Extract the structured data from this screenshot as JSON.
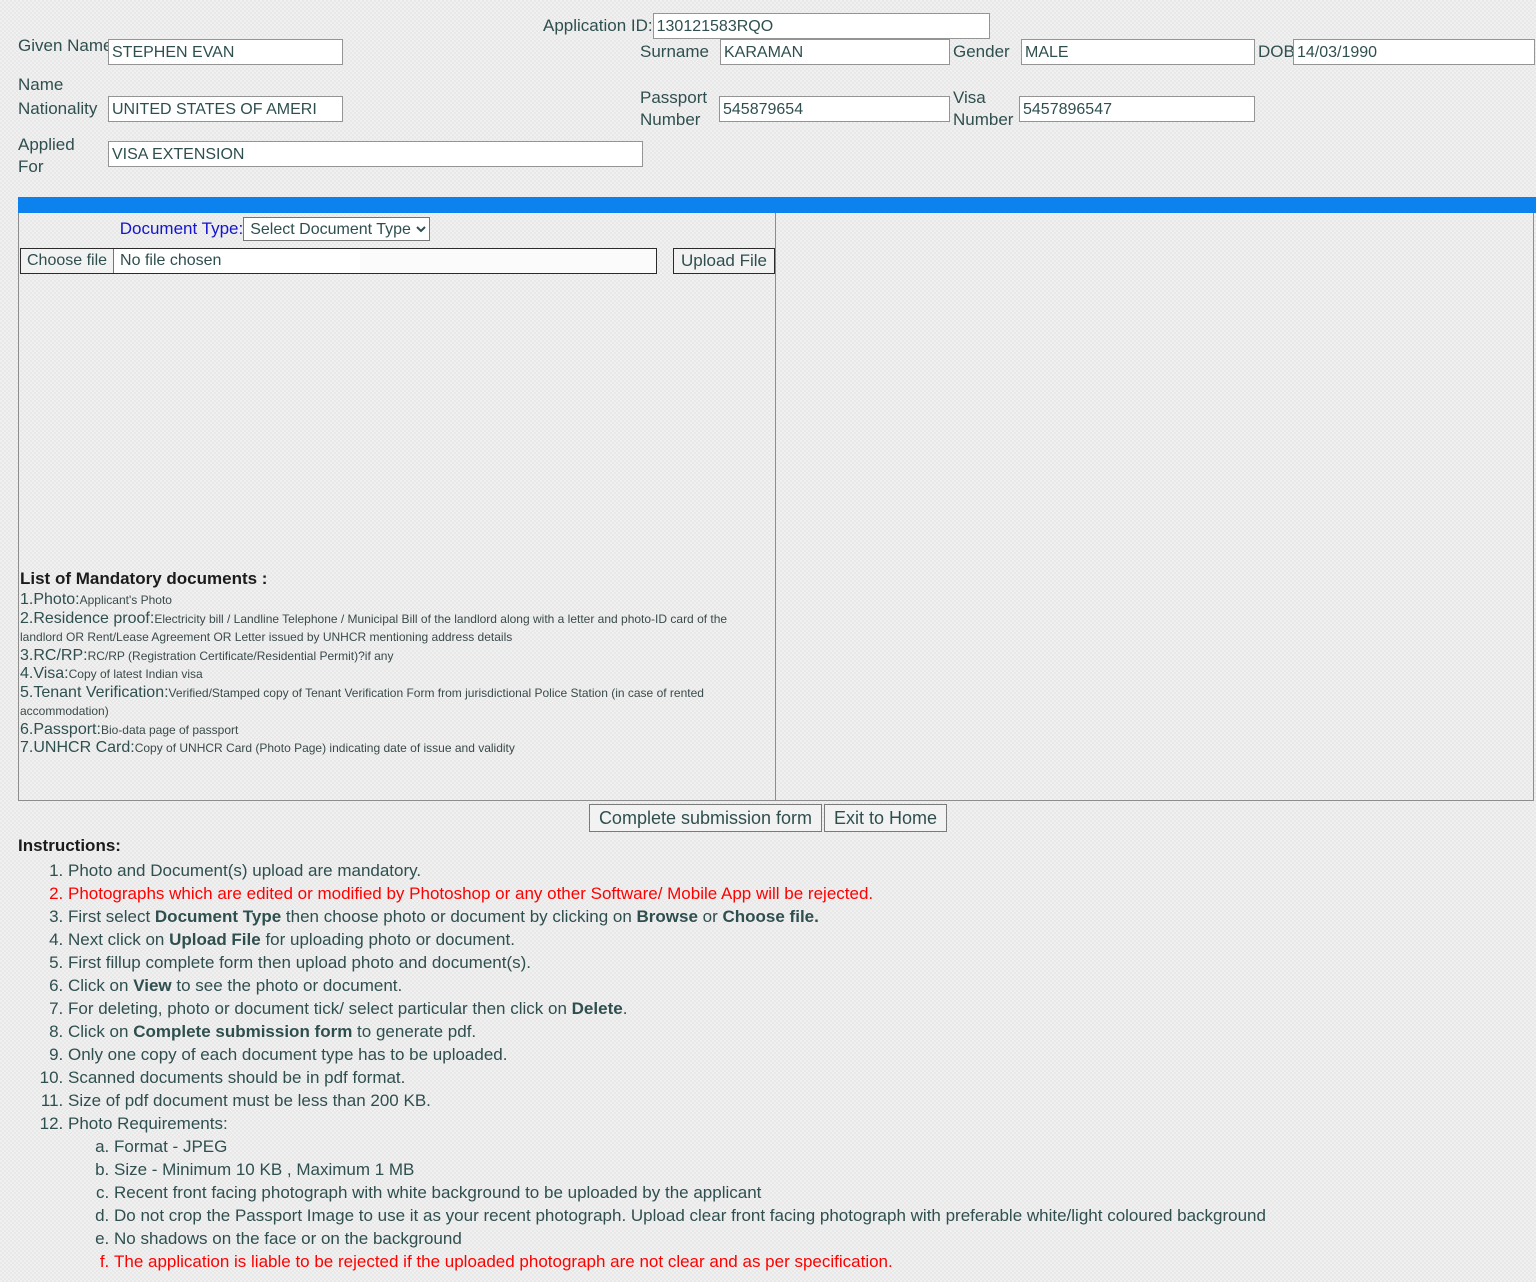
{
  "header": {
    "application_id_label": "Application ID:",
    "application_id_value": "130121583RQO",
    "given_name_label": "Given Name",
    "given_name_value": "STEPHEN EVAN",
    "surname_label": "Surname",
    "surname_value": "KARAMAN",
    "gender_label": "Gender",
    "gender_value": "MALE",
    "dob_label": "DOB",
    "dob_value": "14/03/1990",
    "nationality_label": "Nationality",
    "nationality_value": "UNITED STATES OF AMERI",
    "passport_number_label": "Passport Number",
    "passport_number_value": "545879654",
    "visa_number_label": "Visa Number",
    "visa_number_value": "5457896547",
    "applied_for_label": "Applied For",
    "applied_for_value": "VISA EXTENSION"
  },
  "upload": {
    "document_type_label": "Document Type:",
    "document_type_selected": "Select Document Type",
    "document_type_options": [
      "Select Document Type"
    ],
    "choose_file_label": "Choose file",
    "no_file_chosen": "No file chosen",
    "upload_file_label": "Upload File"
  },
  "mandatory": {
    "title": "List of Mandatory documents :",
    "items": [
      {
        "num": "1.",
        "key": "Photo:",
        "desc": "Applicant's Photo"
      },
      {
        "num": "2.",
        "key": "Residence proof:",
        "desc": "Electricity bill / Landline Telephone / Municipal Bill of the landlord along with a letter and photo-ID card of the landlord OR Rent/Lease Agreement OR Letter issued by UNHCR mentioning address details"
      },
      {
        "num": "3.",
        "key": "RC/RP:",
        "desc": "RC/RP (Registration Certificate/Residential Permit)?if any"
      },
      {
        "num": "4.",
        "key": "Visa:",
        "desc": "Copy of latest Indian visa"
      },
      {
        "num": "5.",
        "key": "Tenant Verification:",
        "desc": "Verified/Stamped copy of Tenant Verification Form from jurisdictional Police Station (in case of rented accommodation)"
      },
      {
        "num": "6.",
        "key": "Passport:",
        "desc": "Bio-data page of passport"
      },
      {
        "num": "7.",
        "key": "UNHCR Card:",
        "desc": "Copy of UNHCR Card (Photo Page) indicating date of issue and validity"
      }
    ]
  },
  "actions": {
    "complete_submission_label": "Complete submission form",
    "exit_to_home_label": "Exit to Home"
  },
  "instructions": {
    "title": "Instructions:",
    "item1": "Photo and Document(s) upload are mandatory.",
    "item2": "Photographs which are edited or modified by Photoshop or any other Software/ Mobile App will be rejected.",
    "item3_a": "First select ",
    "item3_b": "Document Type",
    "item3_c": " then choose photo or document by clicking on ",
    "item3_d": "Browse",
    "item3_e": " or ",
    "item3_f": "Choose file.",
    "item4_a": "Next click on ",
    "item4_b": "Upload File",
    "item4_c": " for uploading photo or document.",
    "item5": "First fillup complete form then upload photo and document(s).",
    "item6_a": "Click on ",
    "item6_b": "View",
    "item6_c": " to see the photo or document.",
    "item7_a": "For deleting, photo or document tick/ select particular then click on ",
    "item7_b": "Delete",
    "item7_c": ".",
    "item8_a": "Click on ",
    "item8_b": "Complete submission form",
    "item8_c": " to generate pdf.",
    "item9": "Only one copy of each document type has to be uploaded.",
    "item10": "Scanned documents should be in pdf format.",
    "item11": "Size of pdf document must be less than 200 KB.",
    "item12": "Photo Requirements:",
    "sub_a": "Format - JPEG",
    "sub_b": "Size - Minimum 10 KB , Maximum 1 MB",
    "sub_c": "Recent front facing photograph with white background to be uploaded by the applicant",
    "sub_d": "Do not crop the Passport Image to use it as your recent photograph. Upload clear front facing photograph with preferable white/light coloured background",
    "sub_e": "No shadows on the face or on the background",
    "sub_f": "The application is liable to be rejected if the uploaded photograph are not clear and as per specification."
  },
  "colors": {
    "accent_bar": "#0b82ee",
    "doc_type_label": "#1414cd",
    "warning": "#ff0000",
    "text": "#2f4f4f"
  }
}
